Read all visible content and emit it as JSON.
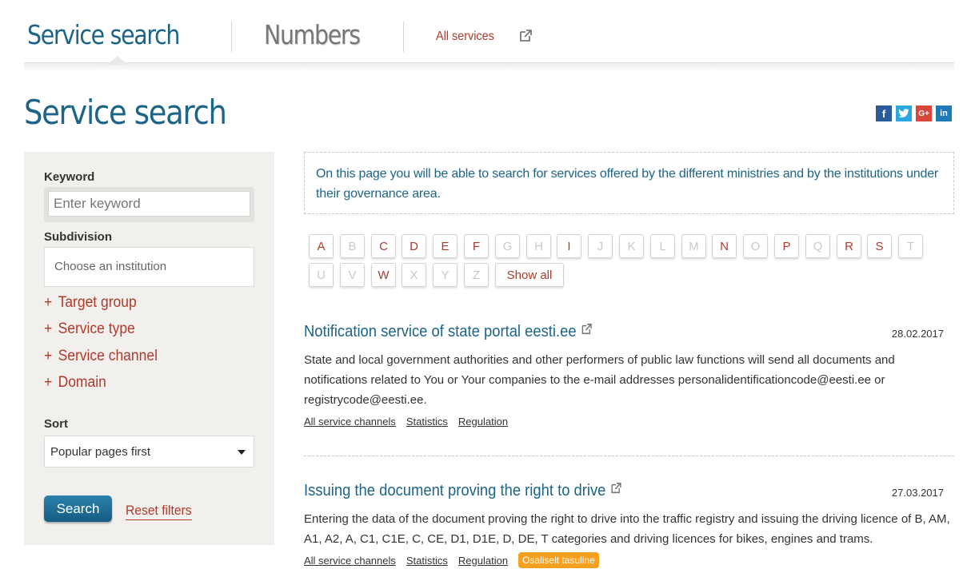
{
  "nav": {
    "tab_service": "Service search",
    "tab_numbers": "Numbers",
    "all_services": "All services",
    "ext_icon": "external-link-icon"
  },
  "page": {
    "title": "Service search"
  },
  "social": [
    "facebook-icon",
    "twitter-icon",
    "google-plus-icon",
    "linkedin-icon"
  ],
  "sidebar": {
    "keyword_label": "Keyword",
    "keyword_placeholder": "Enter keyword",
    "subdivision_label": "Subdivision",
    "subdivision_placeholder": "Choose an institution",
    "filters": [
      "Target group",
      "Service type",
      "Service channel",
      "Domain"
    ],
    "sort_label": "Sort",
    "sort_value": "Popular pages first",
    "search_button": "Search",
    "reset_link": "Reset filters"
  },
  "info": {
    "text": "On this page you will be able to search for services offered by the different ministries and by the institutions under their governance area."
  },
  "letters": {
    "row1": [
      {
        "l": "A",
        "on": true
      },
      {
        "l": "B",
        "on": false
      },
      {
        "l": "C",
        "on": true
      },
      {
        "l": "D",
        "on": true
      },
      {
        "l": "E",
        "on": true
      },
      {
        "l": "F",
        "on": true
      },
      {
        "l": "G",
        "on": false
      },
      {
        "l": "H",
        "on": false
      },
      {
        "l": "I",
        "on": true
      },
      {
        "l": "J",
        "on": false
      },
      {
        "l": "K",
        "on": false
      },
      {
        "l": "L",
        "on": false
      },
      {
        "l": "M",
        "on": false
      },
      {
        "l": "N",
        "on": true
      },
      {
        "l": "O",
        "on": false
      },
      {
        "l": "P",
        "on": true
      },
      {
        "l": "Q",
        "on": false
      },
      {
        "l": "R",
        "on": true
      },
      {
        "l": "S",
        "on": true
      },
      {
        "l": "T",
        "on": false
      }
    ],
    "row2": [
      {
        "l": "U",
        "on": false
      },
      {
        "l": "V",
        "on": false
      },
      {
        "l": "W",
        "on": true
      },
      {
        "l": "X",
        "on": false
      },
      {
        "l": "Y",
        "on": false
      },
      {
        "l": "Z",
        "on": false
      }
    ],
    "show_all": "Show all"
  },
  "results": [
    {
      "title": "Notification service of state portal eesti.ee",
      "date": "28.02.2017",
      "desc": "State and local government authorities and other performers of public law functions will send all documents and notifications related to You or Your companies to the e-mail addresses personalidentificationcode@eesti.ee or registrycode@eesti.ee.",
      "links": [
        "All service channels",
        "Statistics",
        "Regulation"
      ],
      "badge": ""
    },
    {
      "title": "Issuing the document proving the right to drive",
      "date": "27.03.2017",
      "desc": "Entering the data of the document proving the right to drive into the traffic registry and issuing the driving licence of B, AM, A1, A2, A, C1, C1E, C, CE, D1, D1E, D, DE, T categories and driving licences for bikes, engines and trams.",
      "links": [
        "All service channels",
        "Statistics",
        "Regulation"
      ],
      "badge": "Osaliselt tasuline"
    }
  ]
}
